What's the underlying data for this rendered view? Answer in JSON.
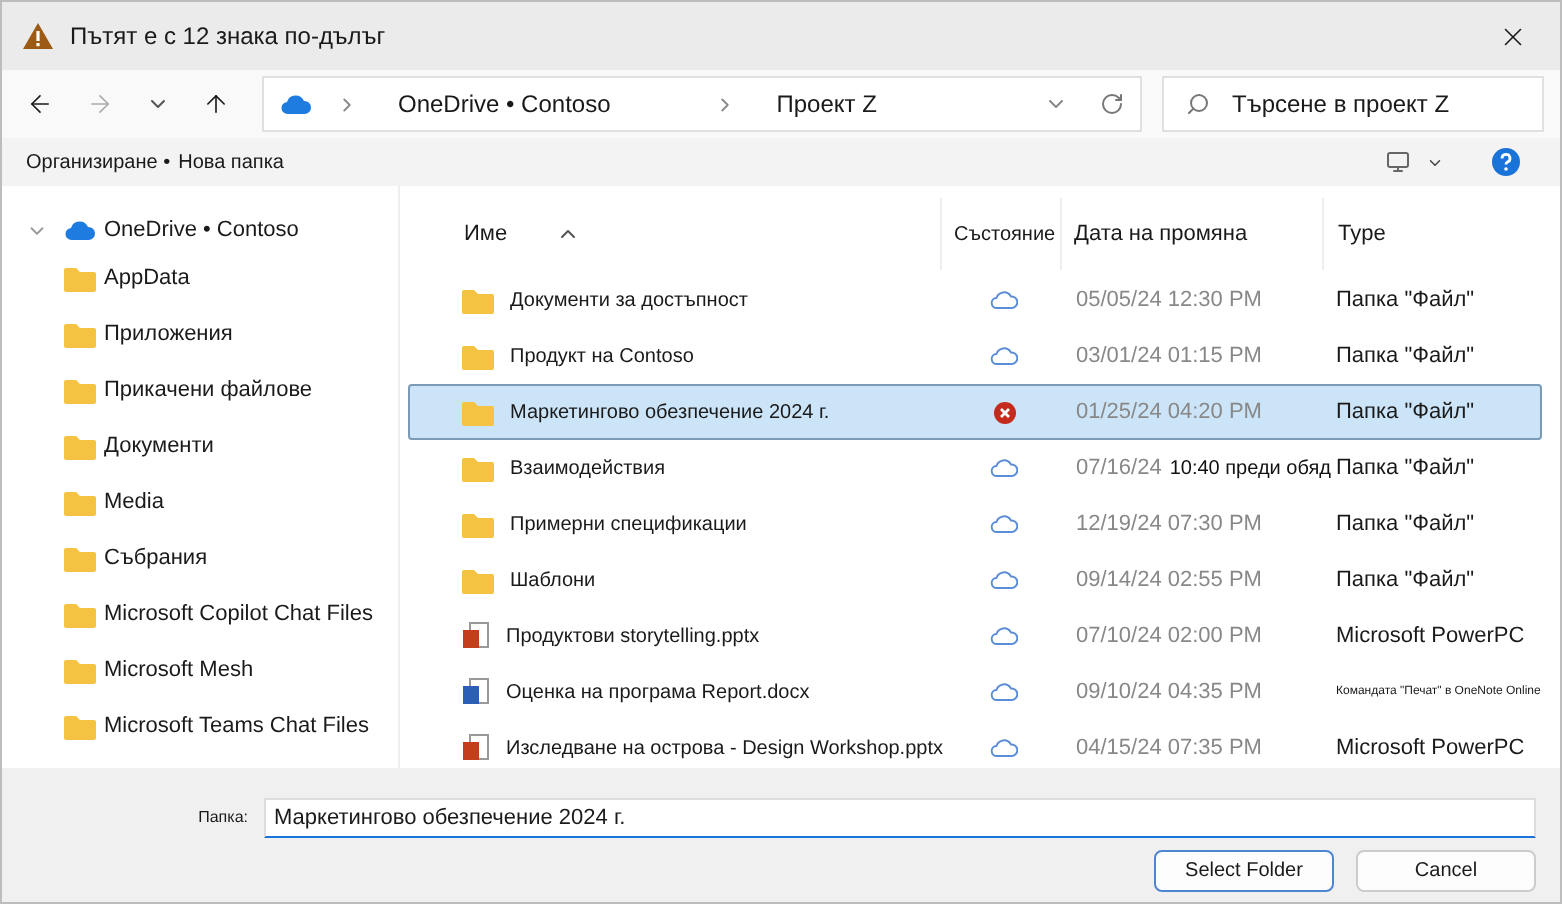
{
  "window": {
    "title": "Пътят е с 12 знака по-дълъг"
  },
  "breadcrumb": [
    "OneDrive • Contoso",
    "Проект Z"
  ],
  "search": {
    "placeholder": "Търсене в проект Z"
  },
  "commands": [
    "Организиране •",
    "Нова папка"
  ],
  "sidebar": {
    "root": {
      "label": "OneDrive • Contoso",
      "expanded": true,
      "children": [
        {
          "label": "AppData"
        },
        {
          "label": "Приложения"
        },
        {
          "label": "Прикачени файлове"
        },
        {
          "label": "Документи"
        },
        {
          "label": "Media"
        },
        {
          "label": "Събрания"
        },
        {
          "label": "Microsoft Copilot Chat Files"
        },
        {
          "label": "Microsoft Mesh"
        },
        {
          "label": "Microsoft Teams Chat Files"
        }
      ]
    }
  },
  "table": {
    "columns": [
      "Име",
      "Състояние",
      "Дата на промяна",
      "Type"
    ],
    "rows": [
      {
        "kind": "folder",
        "name": "Документи за достъпност",
        "status": {
          "kind": "cloud"
        },
        "date": "05/05/24 12:30 PM",
        "type": "Папка \"Файл\"",
        "selected": false
      },
      {
        "kind": "folder",
        "name": "Продукт на Contoso",
        "status": {
          "kind": "cloud"
        },
        "date": "03/01/24 01:15 PM",
        "type": "Папка \"Файл\"",
        "selected": false
      },
      {
        "kind": "folder",
        "name": "Маркетингово обезпечение 2024 г.",
        "status": {
          "kind": "error"
        },
        "date": "01/25/24 04:20 PM",
        "type": "Папка \"Файл\"",
        "selected": true
      },
      {
        "kind": "folder",
        "name": "Взаимодействия",
        "status": {
          "kind": "cloud"
        },
        "date": "07/16/24",
        "time": "10:40 преди обяд",
        "type": "Папка \"Файл\"",
        "selected": false
      },
      {
        "kind": "folder",
        "name": "Примерни спецификации",
        "status": {
          "kind": "cloud"
        },
        "date": "12/19/24 07:30 PM",
        "type": "Папка \"Файл\"",
        "selected": false
      },
      {
        "kind": "folder",
        "name": "Шаблони",
        "status": {
          "kind": "cloud"
        },
        "date": "09/14/24 02:55 PM",
        "type": "Папка \"Файл\"",
        "selected": false
      },
      {
        "kind": "pptx",
        "name": "Продуктови storytelling.pptx",
        "status": {
          "kind": "cloud"
        },
        "date": "07/10/24 02:00 PM",
        "type": "Microsoft PowerPC",
        "selected": false
      },
      {
        "kind": "docx",
        "name": "Оценка на програма Report.docx",
        "status": {
          "kind": "cloud"
        },
        "date": "09/10/24 04:35 PM",
        "type": "Командата \"Печат\" в OneNote Online",
        "selected": false
      },
      {
        "kind": "pptx",
        "name": "Изследване на острова - Design Workshop.pptx",
        "status": {
          "kind": "cloud"
        },
        "date": "04/15/24 07:35 PM",
        "type": "Microsoft PowerPC",
        "selected": false
      }
    ]
  },
  "folder_field": {
    "label": "Папка:",
    "value": "Маркетингово обезпечение 2024 г."
  },
  "buttons": [
    {
      "label": "Select Folder",
      "kind": "primary"
    },
    {
      "label": "Cancel",
      "kind": "secondary"
    }
  ]
}
